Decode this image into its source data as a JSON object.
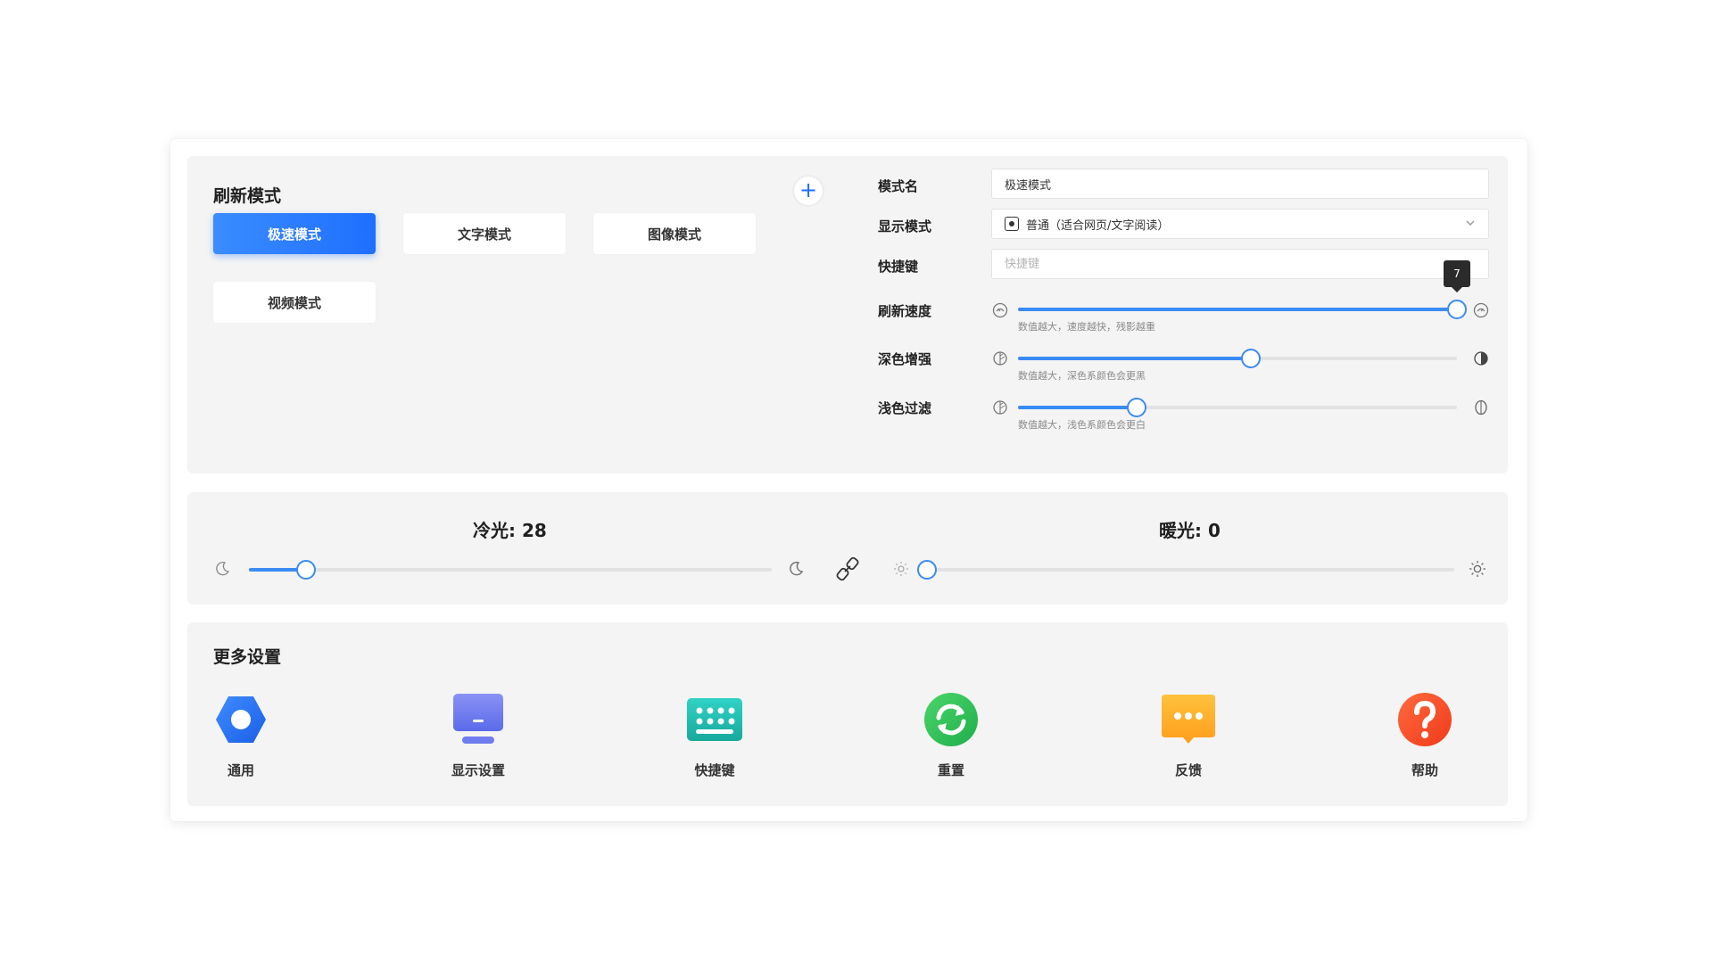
{
  "refresh_mode": {
    "title": "刷新模式",
    "modes": [
      {
        "label": "极速模式",
        "active": true
      },
      {
        "label": "文字模式",
        "active": false
      },
      {
        "label": "图像模式",
        "active": false
      },
      {
        "label": "视频模式",
        "active": false
      }
    ],
    "add_label": "+"
  },
  "form": {
    "name_label": "模式名",
    "name_value": "极速模式",
    "display_label": "显示模式",
    "display_value": "普通（适合网页/文字阅读）",
    "shortcut_label": "快捷键",
    "shortcut_placeholder": "快捷键",
    "sliders": [
      {
        "label": "刷新速度",
        "hint": "数值越大，速度越快，残影越重",
        "value_fraction": 1.0,
        "tooltip": "7"
      },
      {
        "label": "深色增强",
        "hint": "数值越大，深色系颜色会更黑",
        "value_fraction": 0.53
      },
      {
        "label": "浅色过滤",
        "hint": "数值越大，浅色系颜色会更白",
        "value_fraction": 0.27
      }
    ]
  },
  "light": {
    "cold_title": "冷光: 28",
    "warm_title": "暖光: 0",
    "cold_fraction": 0.11,
    "warm_fraction": 0.0
  },
  "more": {
    "title": "更多设置",
    "items": [
      {
        "label": "通用",
        "icon": "settings-hex-icon"
      },
      {
        "label": "显示设置",
        "icon": "monitor-icon"
      },
      {
        "label": "快捷键",
        "icon": "keyboard-icon"
      },
      {
        "label": "重置",
        "icon": "refresh-icon"
      },
      {
        "label": "反馈",
        "icon": "feedback-icon"
      },
      {
        "label": "帮助",
        "icon": "help-icon"
      }
    ]
  },
  "colors": {
    "accent": "#1f6fff",
    "slider": "#3b8bf5",
    "panel": "#f4f4f4"
  }
}
